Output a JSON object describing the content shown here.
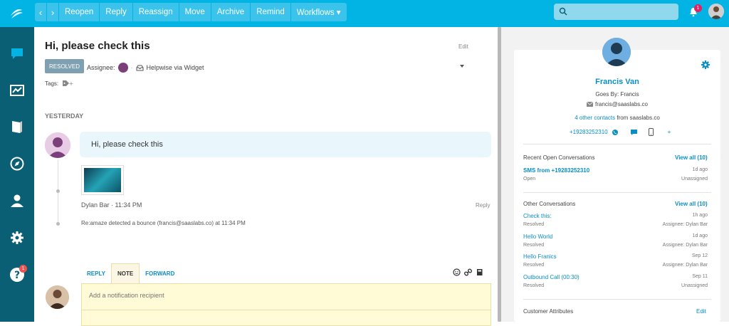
{
  "toolbar": {
    "back_label": "‹",
    "forward_label": "›",
    "reopen": "Reopen",
    "reply": "Reply",
    "reassign": "Reassign",
    "move": "Move",
    "archive": "Archive",
    "remind": "Remind",
    "workflows": "Workflows ▾",
    "search_placeholder": "",
    "notification_count": "1"
  },
  "sidebar": {
    "items": [
      {
        "name": "conversations-icon"
      },
      {
        "name": "reports-icon"
      },
      {
        "name": "knowledge-base-icon"
      },
      {
        "name": "explore-icon"
      },
      {
        "name": "contacts-icon"
      },
      {
        "name": "settings-icon"
      },
      {
        "name": "help-icon",
        "badge": "1"
      }
    ]
  },
  "conversation": {
    "title": "Hi, please check this",
    "edit": "Edit",
    "status": "RESOLVED",
    "assignee_label": "Assignee:",
    "channel": "Helpwise via Widget",
    "tags_label": "Tags:",
    "day_label": "YESTERDAY",
    "message": "Hi, please check this",
    "sender": "Dylan Bar · 11:34 PM",
    "reply_link": "Reply",
    "bounce": "Re:amaze detected a bounce (francis@saaslabs.co) at 11:34 PM"
  },
  "editor": {
    "tabs": [
      "REPLY",
      "NOTE",
      "FORWARD"
    ],
    "active_tab": "NOTE",
    "recipient_placeholder": "Add a notification recipient"
  },
  "contact": {
    "name": "Francis Van",
    "goes_by": "Goes By: Francis",
    "email": "francis@saaslabs.co",
    "other_contacts_link": "4 other contacts",
    "other_contacts_suffix": " from saaslabs.co",
    "phone": "+19283252310",
    "plus": "+"
  },
  "recent_open": {
    "title": "Recent Open Conversations",
    "view_all": "View all (10)",
    "items": [
      {
        "title": "SMS from +19283252310",
        "date": "1d ago",
        "status": "Open",
        "assignee": "Unassigned"
      }
    ]
  },
  "other_conversations": {
    "title": "Other Conversations",
    "view_all": "View all (10)",
    "items": [
      {
        "title": "Check this:",
        "date": "1h ago",
        "status": "Resolved",
        "assignee": "Assignee: Dylan Bar"
      },
      {
        "title": "Hello World",
        "date": "1d ago",
        "status": "Resolved",
        "assignee": "Assignee: Dylan Bar"
      },
      {
        "title": "Hello Franics",
        "date": "Sep 12",
        "status": "Resolved",
        "assignee": "Assignee: Dylan Bar"
      },
      {
        "title": "Outbound Call (00:30)",
        "date": "Sep 11",
        "status": "Resolved",
        "assignee": "Unassigned"
      }
    ]
  },
  "customer_attributes": {
    "title": "Customer Attributes",
    "edit": "Edit"
  },
  "colors": {
    "brand": "#01b4e4",
    "sidebar": "#0a5f74",
    "link": "#0b8ec3",
    "badge": "#e91e63"
  }
}
